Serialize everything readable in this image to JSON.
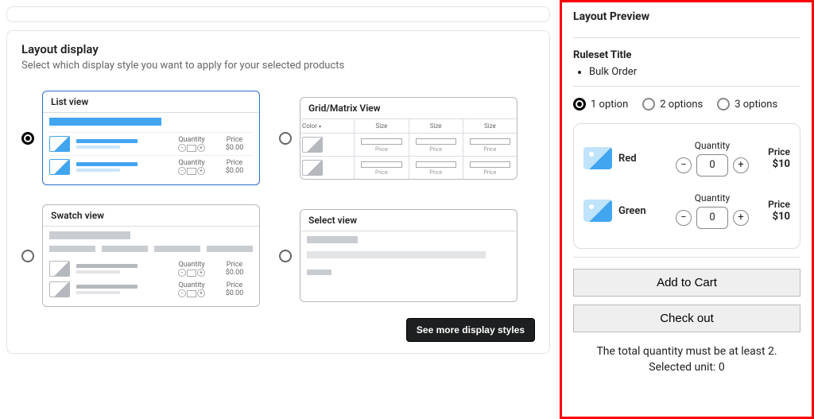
{
  "left": {
    "heading": "Layout display",
    "description": "Select which display style you want to apply for your selected products",
    "options": {
      "list": {
        "title": "List view",
        "qty_label": "Quantity",
        "price_label": "Price",
        "price_val": "$0.00"
      },
      "grid": {
        "title": "Grid/Matrix View",
        "col_color": "Color",
        "col_size": "Size",
        "cell_price": "Price"
      },
      "swatch": {
        "title": "Swatch view",
        "qty_label": "Quantity",
        "price_label": "Price",
        "price_val": "$0.00"
      },
      "select": {
        "title": "Select view"
      }
    },
    "more_btn": "See more display styles"
  },
  "right": {
    "header": "Layout Preview",
    "ruleset_title_label": "Ruleset Title",
    "ruleset_title_value": "Bulk Order",
    "radio_labels": [
      "1 option",
      "2 options",
      "3 options"
    ],
    "qty_label": "Quantity",
    "price_label": "Price",
    "items": [
      {
        "name": "Red",
        "qty": "0",
        "price": "$10"
      },
      {
        "name": "Green",
        "qty": "0",
        "price": "$10"
      }
    ],
    "add_to_cart": "Add to Cart",
    "checkout": "Check out",
    "notice_line1": "The total quantity must be at least 2.",
    "notice_line2": "Selected unit: 0"
  }
}
